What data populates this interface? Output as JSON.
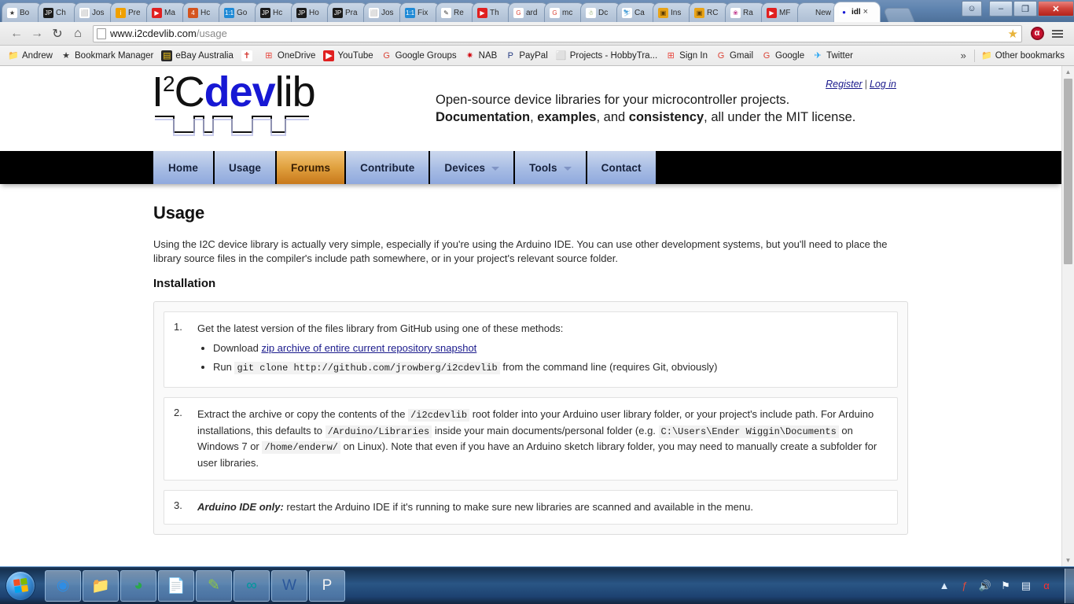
{
  "browser": {
    "tabs": [
      {
        "label": "Bo",
        "icon": "star-icon",
        "icon_bg": "#ffffff",
        "icon_fg": "#333333",
        "glyph": "★"
      },
      {
        "label": "Ch",
        "icon": "jp-icon",
        "icon_bg": "#1b1b1b",
        "icon_fg": "#ffffff",
        "glyph": "JP"
      },
      {
        "label": "Jos",
        "icon": "document-icon",
        "icon_bg": "#ffffff",
        "icon_fg": "#888888",
        "glyph": "⬜"
      },
      {
        "label": "Pre",
        "icon": "instructables-icon",
        "icon_bg": "#f0a000",
        "icon_fg": "#ffffff",
        "glyph": "i"
      },
      {
        "label": "Ma",
        "icon": "youtube-icon",
        "icon_bg": "#e02020",
        "icon_fg": "#ffffff",
        "glyph": "▶"
      },
      {
        "label": "Hc",
        "icon": "channel4-icon",
        "icon_bg": "#d4541e",
        "icon_fg": "#ffffff",
        "glyph": "4"
      },
      {
        "label": "Go",
        "icon": "forum-icon",
        "icon_bg": "#1f8ad6",
        "icon_fg": "#ffffff",
        "glyph": "1:1"
      },
      {
        "label": "Hc",
        "icon": "jp-icon",
        "icon_bg": "#1b1b1b",
        "icon_fg": "#ffffff",
        "glyph": "JP"
      },
      {
        "label": "Ho",
        "icon": "jp-icon",
        "icon_bg": "#1b1b1b",
        "icon_fg": "#ffffff",
        "glyph": "JP"
      },
      {
        "label": "Pra",
        "icon": "jp-icon",
        "icon_bg": "#1b1b1b",
        "icon_fg": "#ffffff",
        "glyph": "JP"
      },
      {
        "label": "Jos",
        "icon": "document-icon",
        "icon_bg": "#ffffff",
        "icon_fg": "#888888",
        "glyph": "⬜"
      },
      {
        "label": "Fix",
        "icon": "forum-icon",
        "icon_bg": "#1f8ad6",
        "icon_fg": "#ffffff",
        "glyph": "1:1"
      },
      {
        "label": "Re",
        "icon": "feather-icon",
        "icon_bg": "#ffffff",
        "icon_fg": "#333333",
        "glyph": "✎"
      },
      {
        "label": "Th",
        "icon": "youtube-icon",
        "icon_bg": "#e02020",
        "icon_fg": "#ffffff",
        "glyph": "▶"
      },
      {
        "label": "ard",
        "icon": "google-icon",
        "icon_bg": "#ffffff",
        "icon_fg": "#db4437",
        "glyph": "G"
      },
      {
        "label": "mc",
        "icon": "google-icon",
        "icon_bg": "#ffffff",
        "icon_fg": "#db4437",
        "glyph": "G"
      },
      {
        "label": "Dc",
        "icon": "snowman-icon",
        "icon_bg": "#ffffff",
        "icon_fg": "#6a8f3a",
        "glyph": "☃"
      },
      {
        "label": "Ca",
        "icon": "runner-icon",
        "icon_bg": "#ffffff",
        "icon_fg": "#4a9fd8",
        "glyph": "⛷"
      },
      {
        "label": "Ins",
        "icon": "instructables-robot-icon",
        "icon_bg": "#e8a317",
        "icon_fg": "#5a3b06",
        "glyph": "▣"
      },
      {
        "label": "RC",
        "icon": "instructables-robot-icon",
        "icon_bg": "#e8a317",
        "icon_fg": "#5a3b06",
        "glyph": "▣"
      },
      {
        "label": "Ra",
        "icon": "balloon-icon",
        "icon_bg": "#ffffff",
        "icon_fg": "#c23b8e",
        "glyph": "❀"
      },
      {
        "label": "MF",
        "icon": "youtube-icon",
        "icon_bg": "#e02020",
        "icon_fg": "#ffffff",
        "glyph": "▶"
      },
      {
        "label": "New T",
        "icon": "none",
        "icon_bg": "transparent",
        "icon_fg": "transparent",
        "glyph": ""
      }
    ],
    "active_tab": {
      "label": "idl",
      "close_glyph": "×"
    },
    "window_controls": {
      "user_glyph": "☺",
      "minimize_glyph": "–",
      "maximize_glyph": "❐",
      "close_glyph": "✕"
    },
    "toolbar": {
      "back_glyph": "←",
      "forward_glyph": "→",
      "reload_glyph": "↻",
      "home_glyph": "⌂",
      "url_main": "www.i2cdevlib.com",
      "url_path": "/usage",
      "star_glyph": "★",
      "avira_label": "α",
      "menu_name": "chrome-menu"
    },
    "bookmarks": [
      {
        "label": "Andrew",
        "icon": "folder-icon",
        "glyph": "📁",
        "bg": "transparent",
        "fg": "#e0a93b"
      },
      {
        "label": "Bookmark Manager",
        "icon": "star-icon",
        "glyph": "★",
        "bg": "transparent",
        "fg": "#3c3c3c"
      },
      {
        "label": "eBay Australia",
        "icon": "ebay-icon",
        "glyph": "▤",
        "bg": "#2a2a2a",
        "fg": "#f0c419"
      },
      {
        "label": "",
        "icon": "tomtom-icon",
        "glyph": "✝",
        "bg": "#ffffff",
        "fg": "#d4322c"
      },
      {
        "label": "OneDrive",
        "icon": "microsoft-icon",
        "glyph": "⊞",
        "bg": "transparent",
        "fg": "#e8453c"
      },
      {
        "label": "YouTube",
        "icon": "youtube-icon",
        "glyph": "▶",
        "bg": "#e02020",
        "fg": "#ffffff"
      },
      {
        "label": "Google Groups",
        "icon": "google-icon",
        "glyph": "G",
        "bg": "transparent",
        "fg": "#db4437"
      },
      {
        "label": "NAB",
        "icon": "nab-icon",
        "glyph": "✷",
        "bg": "transparent",
        "fg": "#d10a11"
      },
      {
        "label": "PayPal",
        "icon": "paypal-icon",
        "glyph": "P",
        "bg": "transparent",
        "fg": "#253b80"
      },
      {
        "label": "Projects - HobbyTra...",
        "icon": "document-icon",
        "glyph": "⬜",
        "bg": "transparent",
        "fg": "#9a9a9a"
      },
      {
        "label": "Sign In",
        "icon": "microsoft-icon",
        "glyph": "⊞",
        "bg": "transparent",
        "fg": "#e8453c"
      },
      {
        "label": "Gmail",
        "icon": "google-icon",
        "glyph": "G",
        "bg": "transparent",
        "fg": "#db4437"
      },
      {
        "label": "Google",
        "icon": "google-icon",
        "glyph": "G",
        "bg": "transparent",
        "fg": "#db4437"
      },
      {
        "label": "Twitter",
        "icon": "twitter-icon",
        "glyph": "✈",
        "bg": "transparent",
        "fg": "#1da1f2"
      }
    ],
    "bookmarks_overflow_glyph": "»",
    "other_bookmarks": {
      "label": "Other bookmarks",
      "glyph": "📁"
    },
    "scrollbar": {
      "up_glyph": "▲",
      "down_glyph": "▼"
    }
  },
  "site": {
    "logo": {
      "part1": "I",
      "sup": "2",
      "part2": "C",
      "blue": "dev",
      "part4": "lib"
    },
    "auth": {
      "register": "Register",
      "separator": "|",
      "login": "Log in"
    },
    "tagline": {
      "line1": "Open-source device libraries for your microcontroller projects.",
      "line2_a": "Documentation",
      "line2_b": ", ",
      "line2_c": "examples",
      "line2_d": ", and ",
      "line2_e": "consistency",
      "line2_f": ", all under the MIT license."
    },
    "nav": [
      {
        "label": "Home",
        "active": false,
        "caret": false
      },
      {
        "label": "Usage",
        "active": false,
        "caret": false
      },
      {
        "label": "Forums",
        "active": true,
        "caret": false
      },
      {
        "label": "Contribute",
        "active": false,
        "caret": false
      },
      {
        "label": "Devices",
        "active": false,
        "caret": true
      },
      {
        "label": "Tools",
        "active": false,
        "caret": true
      },
      {
        "label": "Contact",
        "active": false,
        "caret": false
      }
    ],
    "page": {
      "title": "Usage",
      "intro": "Using the I2C device library is actually very simple, especially if you're using the Arduino IDE. You can use other development systems, but you'll need to place the library source files in the compiler's include path somewhere, or in your project's relevant source folder.",
      "section_title": "Installation",
      "steps": [
        {
          "num": "1.",
          "intro": "Get the latest version of the files library from GitHub using one of these methods:",
          "bullets": [
            {
              "pre": "Download ",
              "link": "zip archive of entire current repository snapshot",
              "post": ""
            },
            {
              "pre": "Run ",
              "code": "git clone http://github.com/jrowberg/i2cdevlib",
              "post": " from the command line (requires Git, obviously)"
            }
          ]
        },
        {
          "num": "2.",
          "p1": "Extract the archive or copy the contents of the ",
          "c1": "/i2cdevlib",
          "p2": " root folder into your Arduino user library folder, or your project's include path. For Arduino installations, this defaults to ",
          "c2": "/Arduino/Libraries",
          "p3": " inside your main documents/personal folder (e.g. ",
          "c3": "C:\\Users\\Ender Wiggin\\Documents",
          "p4": " on Windows 7 or ",
          "c4": "/home/enderw/",
          "p5": " on Linux). Note that even if you have an Arduino sketch library folder, you may need to manually create a subfolder for user libraries."
        },
        {
          "num": "3.",
          "em": "Arduino IDE only:",
          "rest": " restart the Arduino IDE if it's running to make sure new libraries are scanned and available in the menu."
        }
      ]
    }
  },
  "taskbar": {
    "start": {
      "name": "start-orb"
    },
    "apps": [
      {
        "name": "chrome-taskbar-icon",
        "glyph": "◉",
        "color": "#2f8de4"
      },
      {
        "name": "explorer-taskbar-icon",
        "glyph": "📁",
        "color": "#e8b44a"
      },
      {
        "name": "idm-taskbar-icon",
        "glyph": "◕",
        "color": "#2aa84a"
      },
      {
        "name": "notepad-taskbar-icon",
        "glyph": "📄",
        "color": "#cfe4f5"
      },
      {
        "name": "notepadpp-taskbar-icon",
        "glyph": "✎",
        "color": "#8ec642"
      },
      {
        "name": "arduino-taskbar-icon",
        "glyph": "∞",
        "color": "#00979d"
      },
      {
        "name": "word-taskbar-icon",
        "glyph": "W",
        "color": "#2b579a"
      },
      {
        "name": "pspice-taskbar-icon",
        "glyph": "P",
        "color": "#f2f2f2"
      }
    ],
    "tray": [
      {
        "name": "show-hidden-icons-arrow",
        "glyph": "▲",
        "color": "#dcebfa"
      },
      {
        "name": "flash-tray-icon",
        "glyph": "ƒ",
        "color": "#e04b3c"
      },
      {
        "name": "volume-tray-icon",
        "glyph": "🔊",
        "color": "#eaf4ff"
      },
      {
        "name": "action-center-tray-icon",
        "glyph": "⚑",
        "color": "#f2f8ff"
      },
      {
        "name": "network-tray-icon",
        "glyph": "▤",
        "color": "#e8f1fb"
      },
      {
        "name": "avira-tray-icon",
        "glyph": "α",
        "color": "#ff2d2d"
      }
    ]
  }
}
